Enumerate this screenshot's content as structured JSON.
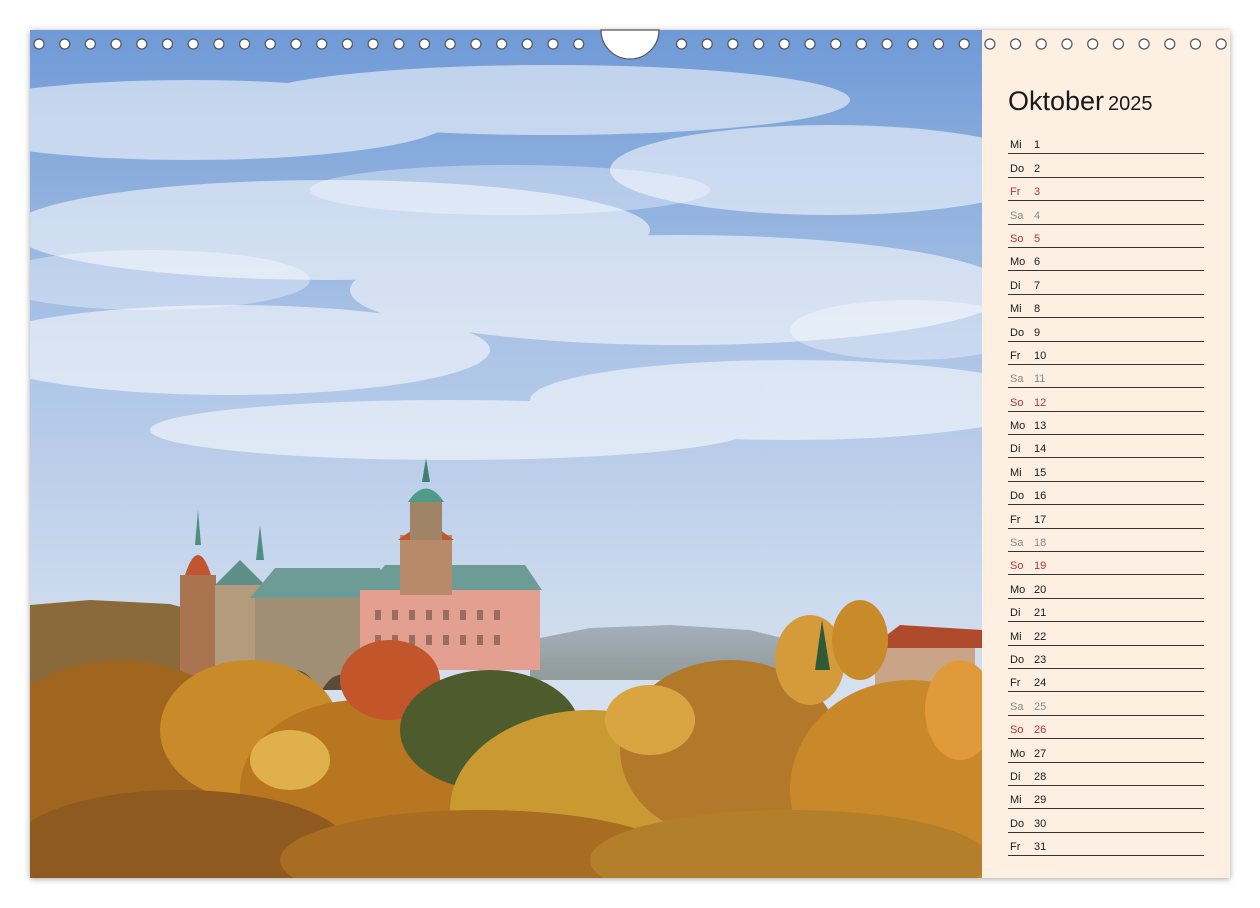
{
  "calendar": {
    "month": "Oktober",
    "year": "2025",
    "days": [
      {
        "wd": "Mi",
        "d": "1",
        "type": "normal"
      },
      {
        "wd": "Do",
        "d": "2",
        "type": "normal"
      },
      {
        "wd": "Fr",
        "d": "3",
        "type": "holiday"
      },
      {
        "wd": "Sa",
        "d": "4",
        "type": "sat"
      },
      {
        "wd": "So",
        "d": "5",
        "type": "sun"
      },
      {
        "wd": "Mo",
        "d": "6",
        "type": "normal"
      },
      {
        "wd": "Di",
        "d": "7",
        "type": "normal"
      },
      {
        "wd": "Mi",
        "d": "8",
        "type": "normal"
      },
      {
        "wd": "Do",
        "d": "9",
        "type": "normal"
      },
      {
        "wd": "Fr",
        "d": "10",
        "type": "normal"
      },
      {
        "wd": "Sa",
        "d": "11",
        "type": "sat"
      },
      {
        "wd": "So",
        "d": "12",
        "type": "sun"
      },
      {
        "wd": "Mo",
        "d": "13",
        "type": "normal"
      },
      {
        "wd": "Di",
        "d": "14",
        "type": "normal"
      },
      {
        "wd": "Mi",
        "d": "15",
        "type": "normal"
      },
      {
        "wd": "Do",
        "d": "16",
        "type": "normal"
      },
      {
        "wd": "Fr",
        "d": "17",
        "type": "normal"
      },
      {
        "wd": "Sa",
        "d": "18",
        "type": "sat"
      },
      {
        "wd": "So",
        "d": "19",
        "type": "sun"
      },
      {
        "wd": "Mo",
        "d": "20",
        "type": "normal"
      },
      {
        "wd": "Di",
        "d": "21",
        "type": "normal"
      },
      {
        "wd": "Mi",
        "d": "22",
        "type": "normal"
      },
      {
        "wd": "Do",
        "d": "23",
        "type": "normal"
      },
      {
        "wd": "Fr",
        "d": "24",
        "type": "normal"
      },
      {
        "wd": "Sa",
        "d": "25",
        "type": "sat"
      },
      {
        "wd": "So",
        "d": "26",
        "type": "sun"
      },
      {
        "wd": "Mo",
        "d": "27",
        "type": "normal"
      },
      {
        "wd": "Di",
        "d": "28",
        "type": "normal"
      },
      {
        "wd": "Mi",
        "d": "29",
        "type": "normal"
      },
      {
        "wd": "Do",
        "d": "30",
        "type": "normal"
      },
      {
        "wd": "Fr",
        "d": "31",
        "type": "normal"
      }
    ]
  },
  "colors": {
    "panel_bg": "#fdf0e3",
    "sunday_holiday": "#b0343a",
    "saturday": "#8a8a8a",
    "sky": "#7fa6d8",
    "foliage": "#c98a2a"
  }
}
